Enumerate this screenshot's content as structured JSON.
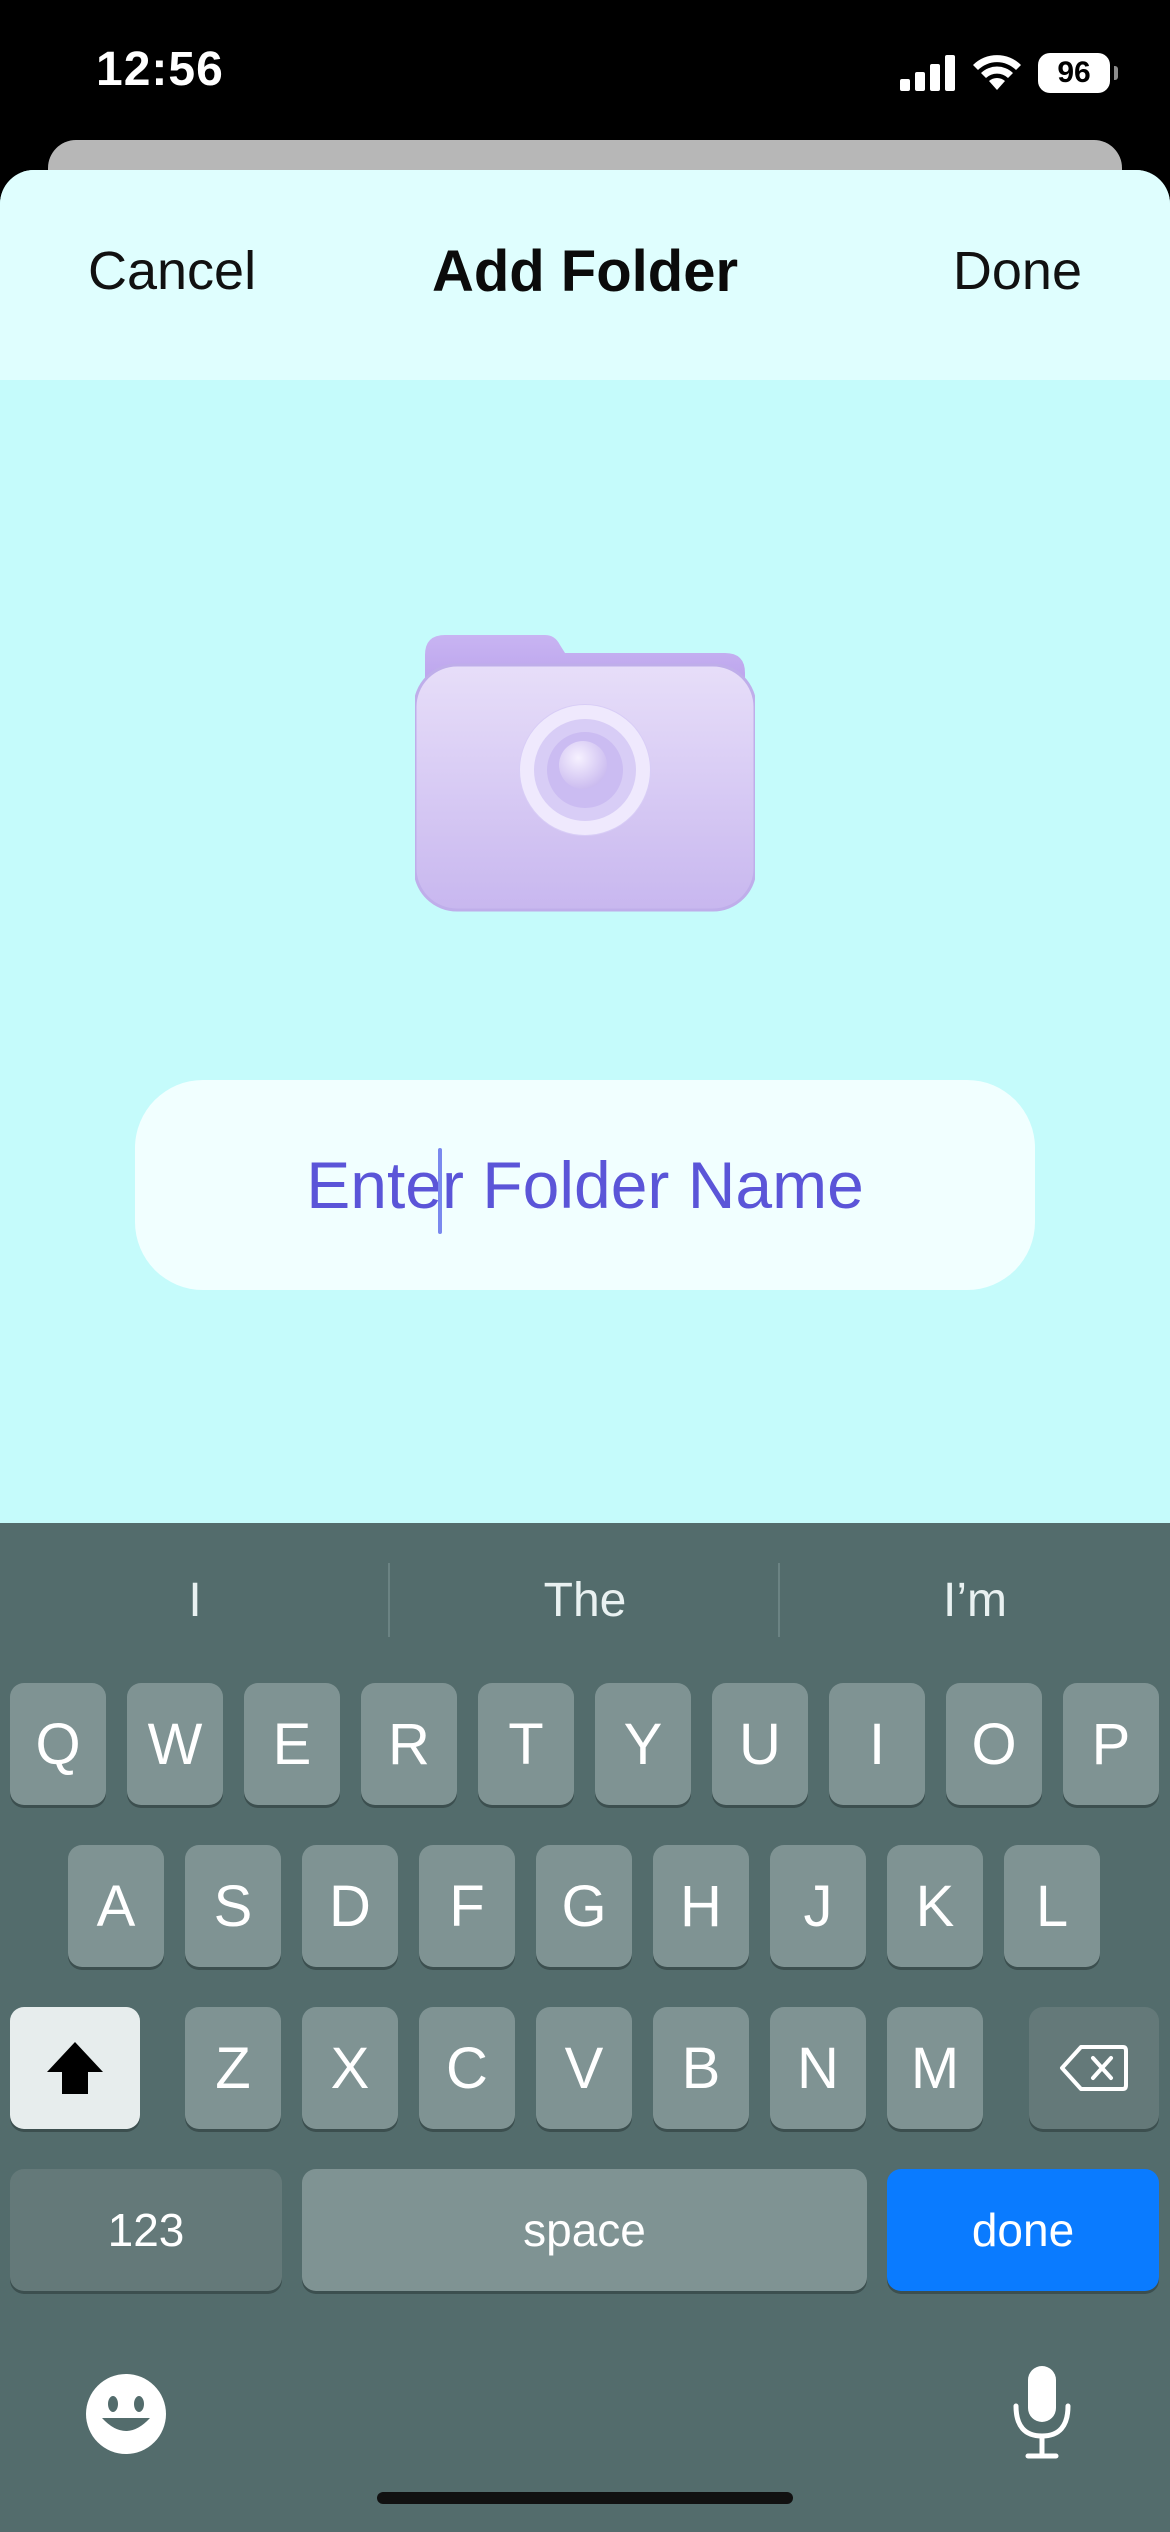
{
  "status_bar": {
    "time": "12:56",
    "battery": "96",
    "icons": [
      "signal-icon",
      "wifi-icon",
      "battery-icon"
    ]
  },
  "modal": {
    "cancel_label": "Cancel",
    "title": "Add Folder",
    "done_label": "Done",
    "folder_icon": "folder-camera-icon",
    "name_field": {
      "placeholder": "Enter Folder Name",
      "value": ""
    }
  },
  "keyboard": {
    "suggestions": [
      "I",
      "The",
      "I’m"
    ],
    "row1": [
      "Q",
      "W",
      "E",
      "R",
      "T",
      "Y",
      "U",
      "I",
      "O",
      "P"
    ],
    "row2": [
      "A",
      "S",
      "D",
      "F",
      "G",
      "H",
      "J",
      "K",
      "L"
    ],
    "row3": [
      "Z",
      "X",
      "C",
      "V",
      "B",
      "N",
      "M"
    ],
    "numbers_label": "123",
    "space_label": "space",
    "done_label": "done",
    "shift_icon": "shift-icon",
    "delete_icon": "backspace-icon",
    "emoji_icon": "emoji-icon",
    "mic_icon": "microphone-icon"
  },
  "colors": {
    "modal_background": "#c5fbfb",
    "nav_background": "#dffefe",
    "placeholder": "#5b55d8",
    "keyboard_background": "#536c6c",
    "done_key": "#0a7bff"
  }
}
